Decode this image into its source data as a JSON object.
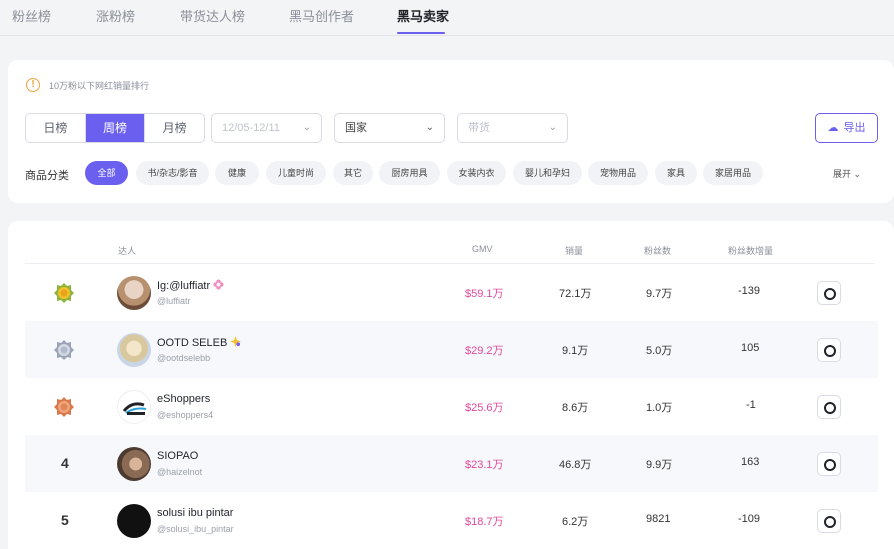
{
  "top_tabs": [
    "粉丝榜",
    "涨粉榜",
    "带货达人榜",
    "黑马创作者",
    "黑马卖家"
  ],
  "notice": "10万粉以下网红销量排行",
  "period_tabs": [
    "日榜",
    "周榜",
    "月榜"
  ],
  "date_select": "12/05-12/11",
  "country_select": "国家",
  "goods_select": "带货",
  "export_label": "导出",
  "category_label": "商品分类",
  "categories": [
    "全部",
    "书/杂志/影音",
    "健康",
    "儿童时尚",
    "其它",
    "厨房用具",
    "女装内衣",
    "婴儿和孕妇",
    "宠物用品",
    "家具",
    "家居用品"
  ],
  "expand_label": "展开",
  "table": {
    "headers": [
      "达人",
      "GMV",
      "销量",
      "粉丝数",
      "粉丝数增量"
    ],
    "rows": [
      {
        "rank": "1",
        "name": "Ig:@luffiatr",
        "handle": "@luffiatr",
        "gmv": "$59.1万",
        "sales": "72.1万",
        "fans": "9.7万",
        "growth": "-139"
      },
      {
        "rank": "2",
        "name": "OOTD SELEB",
        "handle": "@ootdselebb",
        "gmv": "$29.2万",
        "sales": "9.1万",
        "fans": "5.0万",
        "growth": "105"
      },
      {
        "rank": "3",
        "name": "eShoppers",
        "handle": "@eshoppers4",
        "gmv": "$25.6万",
        "sales": "8.6万",
        "fans": "1.0万",
        "growth": "-1"
      },
      {
        "rank": "4",
        "name": "SIOPAO",
        "handle": "@haizelnot",
        "gmv": "$23.1万",
        "sales": "46.8万",
        "fans": "9.9万",
        "growth": "163"
      },
      {
        "rank": "5",
        "name": "solusi ibu pintar",
        "handle": "@solusi_ibu_pintar",
        "gmv": "$18.7万",
        "sales": "6.2万",
        "fans": "9821",
        "growth": "-109"
      }
    ]
  },
  "colors": {
    "accent": "#6b5ff0",
    "gmv": "#e0489d",
    "warning": "#f0a23b"
  }
}
